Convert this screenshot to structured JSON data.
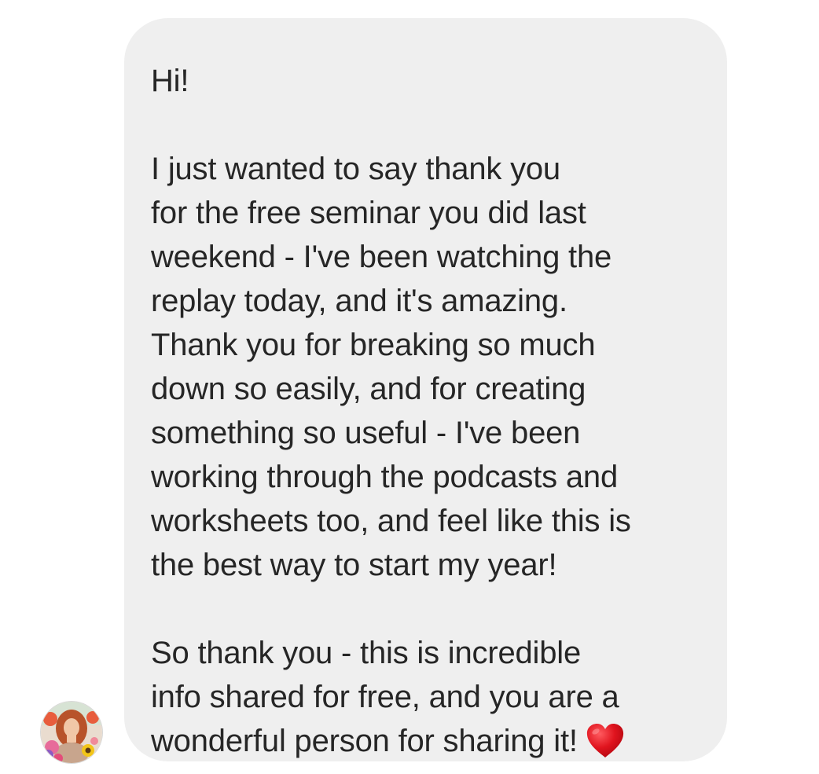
{
  "message": {
    "greeting": "Hi!",
    "paragraph1": [
      "I just wanted to say thank you",
      "for the free seminar you did last",
      "weekend - I've been watching the",
      "replay today, and it's amazing.",
      "Thank you for breaking so much",
      "down so easily, and for creating",
      "something so useful - I've been",
      "working through the podcasts and",
      "worksheets too, and feel like this is",
      "the best way to start my year!"
    ],
    "paragraph2": [
      "So thank you - this is incredible",
      "info shared for free, and you are a",
      "wonderful person for sharing it!"
    ],
    "emoji": "heart-emoji"
  },
  "colors": {
    "bubble_background": "#efefef",
    "text": "#262626",
    "heart": "#e0141e"
  },
  "sender": {
    "avatar": "avatar"
  }
}
